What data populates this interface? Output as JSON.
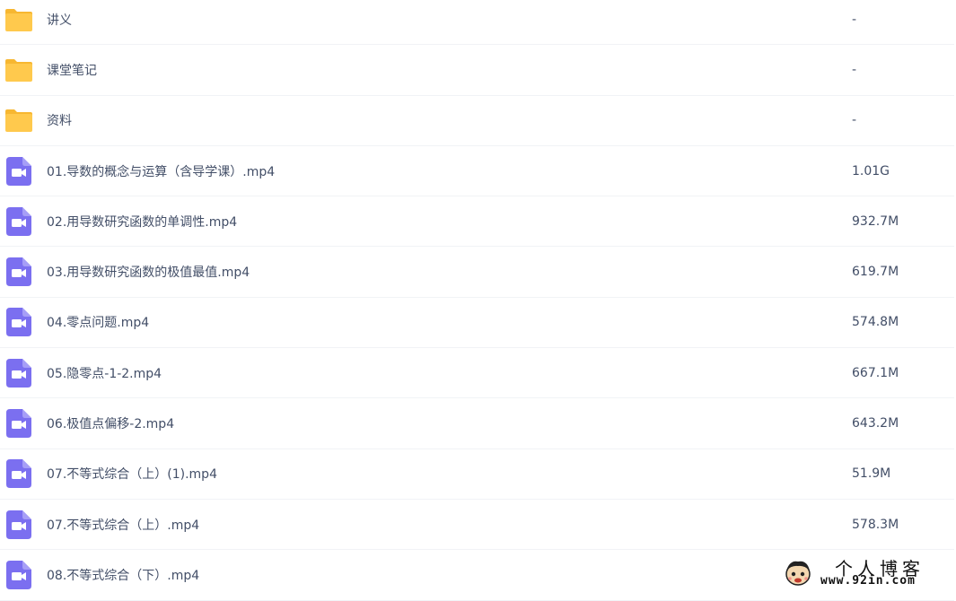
{
  "files": [
    {
      "type": "folder",
      "icon": "folder-icon",
      "name": "讲义",
      "size": "-"
    },
    {
      "type": "folder",
      "icon": "folder-icon",
      "name": "课堂笔记",
      "size": "-"
    },
    {
      "type": "folder",
      "icon": "folder-icon",
      "name": "资料",
      "size": "-"
    },
    {
      "type": "video",
      "icon": "video-file-icon",
      "name": "01.导数的概念与运算（含导学课）.mp4",
      "size": "1.01G"
    },
    {
      "type": "video",
      "icon": "video-file-icon",
      "name": "02.用导数研究函数的单调性.mp4",
      "size": "932.7M"
    },
    {
      "type": "video",
      "icon": "video-file-icon",
      "name": "03.用导数研究函数的极值最值.mp4",
      "size": "619.7M"
    },
    {
      "type": "video",
      "icon": "video-file-icon",
      "name": "04.零点问题.mp4",
      "size": "574.8M"
    },
    {
      "type": "video",
      "icon": "video-file-icon",
      "name": "05.隐零点-1-2.mp4",
      "size": "667.1M"
    },
    {
      "type": "video",
      "icon": "video-file-icon",
      "name": "06.极值点偏移-2.mp4",
      "size": "643.2M"
    },
    {
      "type": "video",
      "icon": "video-file-icon",
      "name": "07.不等式综合（上）(1).mp4",
      "size": "51.9M"
    },
    {
      "type": "video",
      "icon": "video-file-icon",
      "name": "07.不等式综合（上）.mp4",
      "size": "578.3M"
    },
    {
      "type": "video",
      "icon": "video-file-icon",
      "name": "08.不等式综合（下）.mp4",
      "size": ""
    }
  ],
  "watermark": {
    "title": "个人博客",
    "url": "www.92in.com",
    "mascot_icon": "mascot-icon"
  },
  "colors": {
    "folder": "#ffc94d",
    "folder_tab": "#f7b731",
    "video": "#7b6ff0",
    "text": "#424e67",
    "divider": "#f1f3f6"
  }
}
